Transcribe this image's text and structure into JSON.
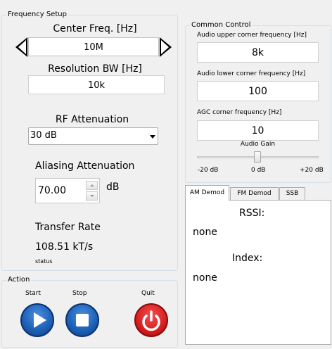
{
  "frequency_setup": {
    "title": "Frequency Setup",
    "center_freq_label": "Center Freq. [Hz]",
    "center_freq_value": "10M",
    "resolution_bw_label": "Resolution BW [Hz]",
    "resolution_bw_value": "10k",
    "rf_attenuation_label": "RF Attenuation",
    "rf_attenuation_selected": "30 dB",
    "aliasing_attenuation_label": "Aliasing Attenuation",
    "aliasing_attenuation_value": "70.00",
    "aliasing_attenuation_unit": "dB",
    "transfer_rate_label": "Transfer Rate",
    "transfer_rate_value": "108.51 kT/s",
    "status_label": "status"
  },
  "common_control": {
    "title": "Common Control",
    "audio_upper_label": "Audio upper corner frequency [Hz]",
    "audio_upper_value": "8k",
    "audio_lower_label": "Audio lower corner frequency [Hz]",
    "audio_lower_value": "100",
    "agc_label": "AGC corner frequency [Hz]",
    "agc_value": "10",
    "audio_gain_label": "Audio Gain",
    "audio_gain_min": "-20 dB",
    "audio_gain_mid": "0 dB",
    "audio_gain_max": "+20 dB"
  },
  "demod": {
    "tabs": [
      "AM Demod",
      "FM Demod",
      "SSB"
    ],
    "active_tab": "AM Demod",
    "rssi_label": "RSSI:",
    "rssi_value": "none",
    "index_label": "Index:",
    "index_value": "none"
  },
  "action": {
    "title": "Action",
    "start_label": "Start",
    "stop_label": "Stop",
    "quit_label": "Quit",
    "start_icon": "play-icon",
    "stop_icon": "stop-icon",
    "quit_icon": "power-icon"
  },
  "colors": {
    "start_stop_button": "#1a5fb4",
    "quit_button": "#d81e1e"
  }
}
